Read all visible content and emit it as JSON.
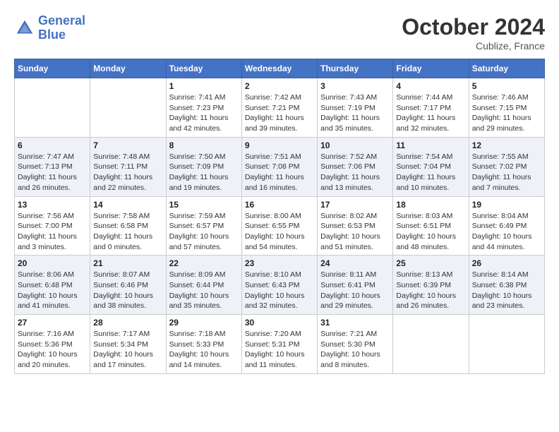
{
  "header": {
    "logo_line1": "General",
    "logo_line2": "Blue",
    "month_year": "October 2024",
    "location": "Cublize, France"
  },
  "weekdays": [
    "Sunday",
    "Monday",
    "Tuesday",
    "Wednesday",
    "Thursday",
    "Friday",
    "Saturday"
  ],
  "weeks": [
    [
      {
        "day": "",
        "info": ""
      },
      {
        "day": "",
        "info": ""
      },
      {
        "day": "1",
        "info": "Sunrise: 7:41 AM\nSunset: 7:23 PM\nDaylight: 11 hours and 42 minutes."
      },
      {
        "day": "2",
        "info": "Sunrise: 7:42 AM\nSunset: 7:21 PM\nDaylight: 11 hours and 39 minutes."
      },
      {
        "day": "3",
        "info": "Sunrise: 7:43 AM\nSunset: 7:19 PM\nDaylight: 11 hours and 35 minutes."
      },
      {
        "day": "4",
        "info": "Sunrise: 7:44 AM\nSunset: 7:17 PM\nDaylight: 11 hours and 32 minutes."
      },
      {
        "day": "5",
        "info": "Sunrise: 7:46 AM\nSunset: 7:15 PM\nDaylight: 11 hours and 29 minutes."
      }
    ],
    [
      {
        "day": "6",
        "info": "Sunrise: 7:47 AM\nSunset: 7:13 PM\nDaylight: 11 hours and 26 minutes."
      },
      {
        "day": "7",
        "info": "Sunrise: 7:48 AM\nSunset: 7:11 PM\nDaylight: 11 hours and 22 minutes."
      },
      {
        "day": "8",
        "info": "Sunrise: 7:50 AM\nSunset: 7:09 PM\nDaylight: 11 hours and 19 minutes."
      },
      {
        "day": "9",
        "info": "Sunrise: 7:51 AM\nSunset: 7:08 PM\nDaylight: 11 hours and 16 minutes."
      },
      {
        "day": "10",
        "info": "Sunrise: 7:52 AM\nSunset: 7:06 PM\nDaylight: 11 hours and 13 minutes."
      },
      {
        "day": "11",
        "info": "Sunrise: 7:54 AM\nSunset: 7:04 PM\nDaylight: 11 hours and 10 minutes."
      },
      {
        "day": "12",
        "info": "Sunrise: 7:55 AM\nSunset: 7:02 PM\nDaylight: 11 hours and 7 minutes."
      }
    ],
    [
      {
        "day": "13",
        "info": "Sunrise: 7:56 AM\nSunset: 7:00 PM\nDaylight: 11 hours and 3 minutes."
      },
      {
        "day": "14",
        "info": "Sunrise: 7:58 AM\nSunset: 6:58 PM\nDaylight: 11 hours and 0 minutes."
      },
      {
        "day": "15",
        "info": "Sunrise: 7:59 AM\nSunset: 6:57 PM\nDaylight: 10 hours and 57 minutes."
      },
      {
        "day": "16",
        "info": "Sunrise: 8:00 AM\nSunset: 6:55 PM\nDaylight: 10 hours and 54 minutes."
      },
      {
        "day": "17",
        "info": "Sunrise: 8:02 AM\nSunset: 6:53 PM\nDaylight: 10 hours and 51 minutes."
      },
      {
        "day": "18",
        "info": "Sunrise: 8:03 AM\nSunset: 6:51 PM\nDaylight: 10 hours and 48 minutes."
      },
      {
        "day": "19",
        "info": "Sunrise: 8:04 AM\nSunset: 6:49 PM\nDaylight: 10 hours and 44 minutes."
      }
    ],
    [
      {
        "day": "20",
        "info": "Sunrise: 8:06 AM\nSunset: 6:48 PM\nDaylight: 10 hours and 41 minutes."
      },
      {
        "day": "21",
        "info": "Sunrise: 8:07 AM\nSunset: 6:46 PM\nDaylight: 10 hours and 38 minutes."
      },
      {
        "day": "22",
        "info": "Sunrise: 8:09 AM\nSunset: 6:44 PM\nDaylight: 10 hours and 35 minutes."
      },
      {
        "day": "23",
        "info": "Sunrise: 8:10 AM\nSunset: 6:43 PM\nDaylight: 10 hours and 32 minutes."
      },
      {
        "day": "24",
        "info": "Sunrise: 8:11 AM\nSunset: 6:41 PM\nDaylight: 10 hours and 29 minutes."
      },
      {
        "day": "25",
        "info": "Sunrise: 8:13 AM\nSunset: 6:39 PM\nDaylight: 10 hours and 26 minutes."
      },
      {
        "day": "26",
        "info": "Sunrise: 8:14 AM\nSunset: 6:38 PM\nDaylight: 10 hours and 23 minutes."
      }
    ],
    [
      {
        "day": "27",
        "info": "Sunrise: 7:16 AM\nSunset: 5:36 PM\nDaylight: 10 hours and 20 minutes."
      },
      {
        "day": "28",
        "info": "Sunrise: 7:17 AM\nSunset: 5:34 PM\nDaylight: 10 hours and 17 minutes."
      },
      {
        "day": "29",
        "info": "Sunrise: 7:18 AM\nSunset: 5:33 PM\nDaylight: 10 hours and 14 minutes."
      },
      {
        "day": "30",
        "info": "Sunrise: 7:20 AM\nSunset: 5:31 PM\nDaylight: 10 hours and 11 minutes."
      },
      {
        "day": "31",
        "info": "Sunrise: 7:21 AM\nSunset: 5:30 PM\nDaylight: 10 hours and 8 minutes."
      },
      {
        "day": "",
        "info": ""
      },
      {
        "day": "",
        "info": ""
      }
    ]
  ]
}
